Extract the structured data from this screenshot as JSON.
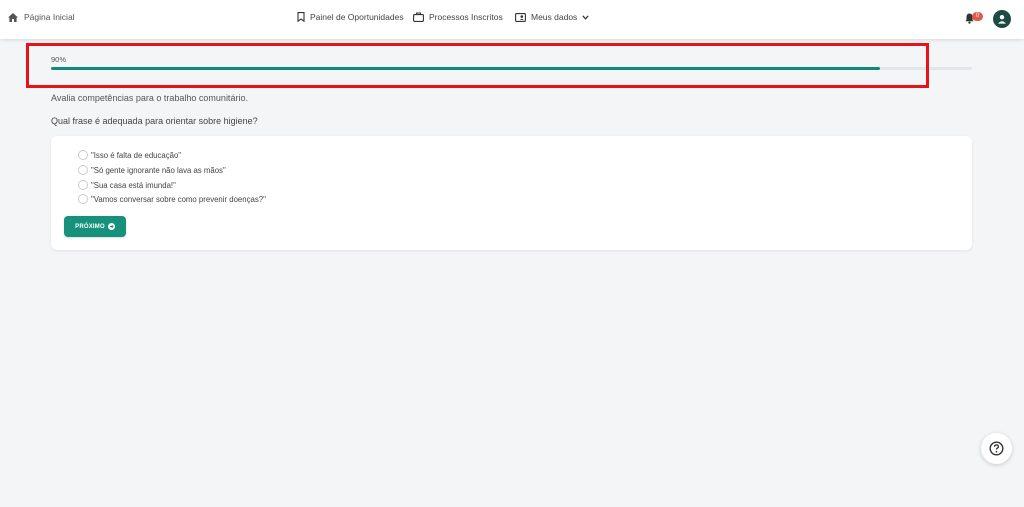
{
  "header": {
    "home_label": "Página Inicial",
    "nav": [
      {
        "label": "Painel de Oportunidades",
        "icon": "bookmark-icon"
      },
      {
        "label": "Processos Inscritos",
        "icon": "briefcase-icon"
      },
      {
        "label": "Meus dados",
        "icon": "id-card-icon"
      }
    ],
    "notification_count": "0"
  },
  "progress": {
    "label": "90%",
    "value": 0.9,
    "color": "#0f8a78"
  },
  "quiz": {
    "description": "Avalia competências para o trabalho comunitário.",
    "question": "Qual frase é adequada para orientar sobre higiene?",
    "options": [
      "\"Isso é falta de educação\"",
      "\"Só gente ignorante não lava as mãos\"",
      "\"Sua casa está imunda!\"",
      "\"Vamos conversar sobre como prevenir doenças?\""
    ],
    "next_label": "PRÓXIMO"
  },
  "colors": {
    "accent": "#15917c",
    "highlight": "#e8131a",
    "badge": "#e15b4c",
    "avatar": "#1d4a44"
  }
}
